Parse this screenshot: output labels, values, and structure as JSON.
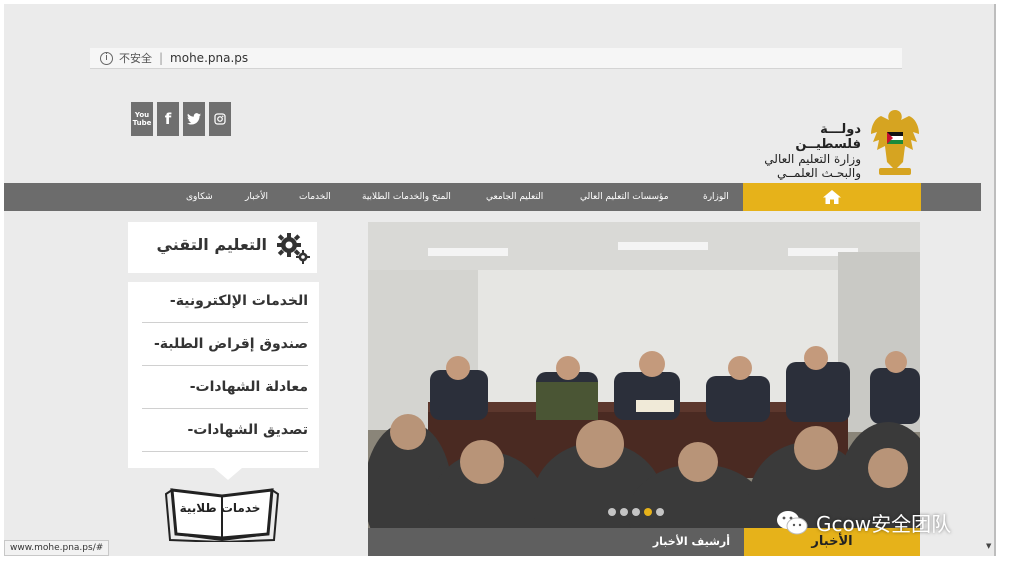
{
  "browser": {
    "security_label": "不安全",
    "url": "mohe.pna.ps",
    "status_url": "www.mohe.pna.ps/#"
  },
  "header": {
    "state_name": "دولـــة فلسطيــن",
    "ministry_line1": "وزارة التعليم العالي",
    "ministry_line2": "والبحـث العلمــي",
    "social": [
      "You Tube",
      "f",
      "twitter",
      "instagram"
    ]
  },
  "nav": {
    "items": [
      "الوزارة",
      "مؤسسات التعليم العالي",
      "التعليم الجامعي",
      "المنح والخدمات الطلابية",
      "الخدمات",
      "الأخبار",
      "شكاوى"
    ]
  },
  "sidebar": {
    "tech_title": "التعليم التقني",
    "items": [
      "الخدمات الإلكترونية",
      "صندوق إقراض الطلبة",
      "معادلة الشهادات",
      "تصديق الشهادات"
    ],
    "student_services": "خدمات طلابية"
  },
  "slider": {
    "dots": 5,
    "active_dot": 4,
    "archive_label": "أرشيف الأخبار",
    "news_label": "الأخبار"
  },
  "watermark": {
    "text": "Gcow安全团队"
  },
  "colors": {
    "accent": "#e6b21a",
    "nav_bg": "#6c6c6c",
    "page_bg": "#ebebeb"
  }
}
